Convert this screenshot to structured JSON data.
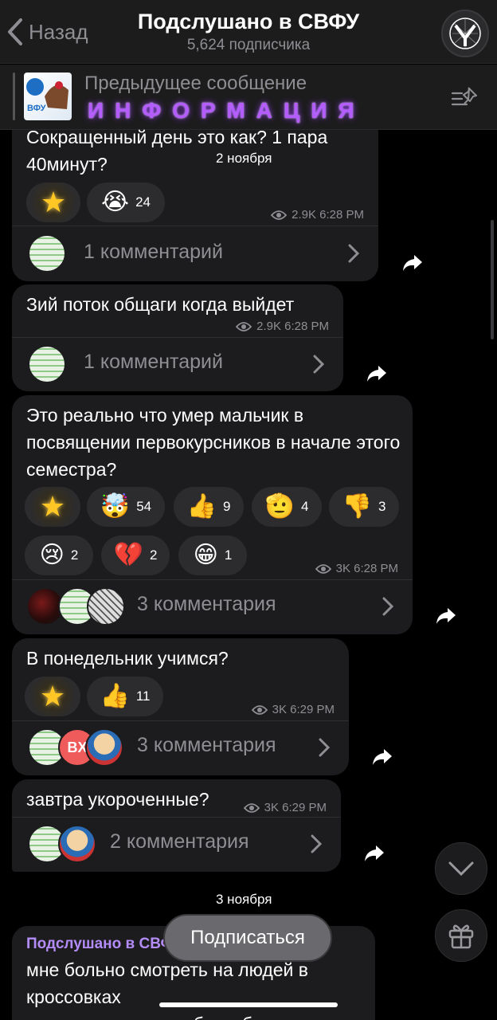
{
  "header": {
    "back_label": "Назад",
    "title": "Подслушано в СВФУ",
    "subtitle": "5,624 подписчика"
  },
  "pinned": {
    "label": "Предыдущее сообщение",
    "text": "ИНФОРМАЦИЯ",
    "thumb_text": "ВФУ"
  },
  "messages": [
    {
      "text": "Сокращенный день это как? 1 пара 40минут?",
      "reactions": [
        {
          "emoji": "⭐",
          "count": ""
        },
        {
          "emoji": "😭",
          "count": "24"
        }
      ],
      "views": "2.9K 6:28 PM",
      "comments": "1 комментарий"
    },
    {
      "text": "Зий поток общаги когда выйдет",
      "views": "2.9K 6:28 PM",
      "comments": "1 комментарий"
    },
    {
      "text": "Это реально что умер мальчик в посвящении первокурсников в начале этого семестра?",
      "reactions": [
        {
          "emoji": "⭐",
          "count": ""
        },
        {
          "emoji": "🤯",
          "count": "54"
        },
        {
          "emoji": "👍",
          "count": "9"
        },
        {
          "emoji": "🫡",
          "count": "4"
        },
        {
          "emoji": "👎",
          "count": "3"
        },
        {
          "emoji": "😢",
          "count": "2"
        },
        {
          "emoji": "💔",
          "count": "2"
        },
        {
          "emoji": "😁",
          "count": "1"
        }
      ],
      "views": "3K 6:28 PM",
      "comments": "3 комментария"
    },
    {
      "text": "В понедельник учимся?",
      "reactions": [
        {
          "emoji": "⭐",
          "count": ""
        },
        {
          "emoji": "👍",
          "count": "11"
        }
      ],
      "views": "3K 6:29 PM",
      "comments": "3 комментария",
      "avatar_text": "BX"
    },
    {
      "text": "завтра укороченные?",
      "views": "3K 6:29 PM",
      "comments": "2 комментария"
    },
    {
      "sender": "Подслушано в СВФУ",
      "text_line1": "мне больно смотреть на людей в",
      "text_line2": "кроссовках",
      "text_line3": "наденьте зимнюю обувь, берегите"
    }
  ],
  "dates": {
    "first": "2 ноября",
    "second": "3 ноября"
  },
  "subscribe_label": "Подписаться",
  "icons": [
    "chevron-left-icon",
    "eye-icon",
    "chevron-right-icon",
    "share-icon",
    "pin-list-icon",
    "chevron-down-icon",
    "gift-icon"
  ]
}
